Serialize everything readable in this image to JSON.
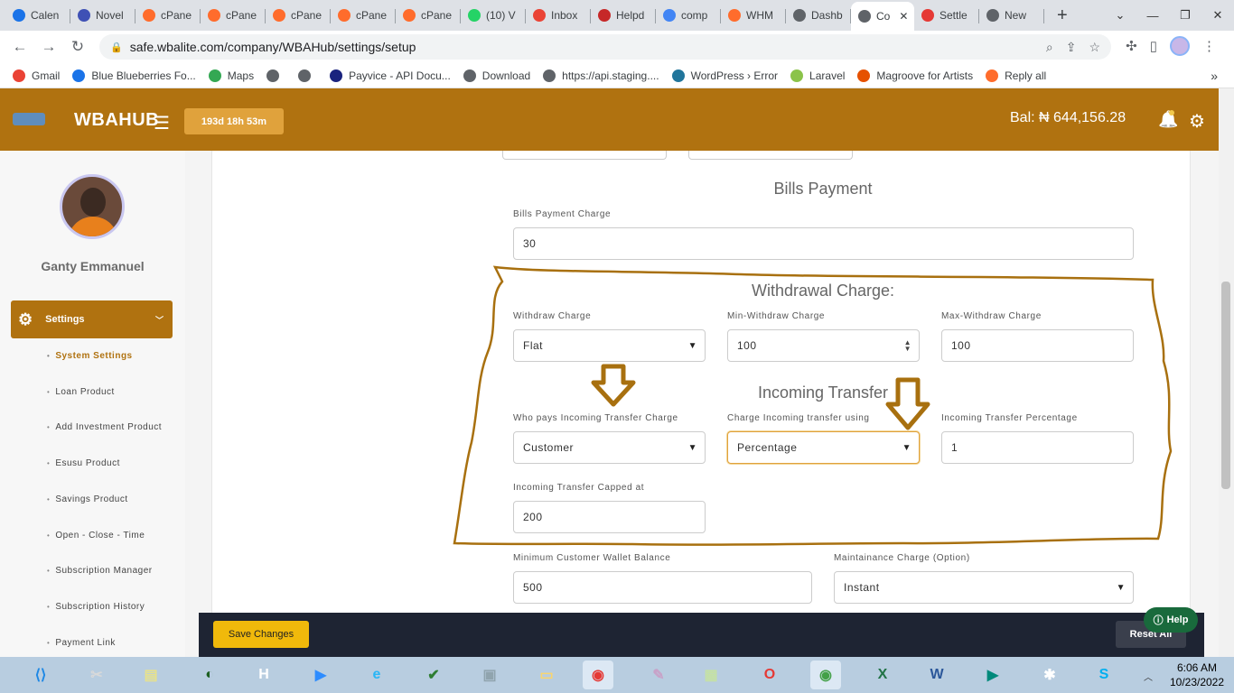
{
  "browser": {
    "tabs": [
      {
        "label": "Calen",
        "color": "#1a73e8"
      },
      {
        "label": "Novel",
        "color": "#3f51b5"
      },
      {
        "label": "cPane",
        "color": "#ff6c2c"
      },
      {
        "label": "cPane",
        "color": "#ff6c2c"
      },
      {
        "label": "cPane",
        "color": "#ff6c2c"
      },
      {
        "label": "cPane",
        "color": "#ff6c2c"
      },
      {
        "label": "cPane",
        "color": "#ff6c2c"
      },
      {
        "label": "(10) V",
        "color": "#25d366"
      },
      {
        "label": "Inbox",
        "color": "#ea4335"
      },
      {
        "label": "Helpd",
        "color": "#c62828"
      },
      {
        "label": "comp",
        "color": "#4285f4"
      },
      {
        "label": "WHM",
        "color": "#ff6c2c"
      },
      {
        "label": "Dashb",
        "color": "#5f6368"
      },
      {
        "label": "Co",
        "color": "#5f6368",
        "active": true
      },
      {
        "label": "Settle",
        "color": "#e53935"
      },
      {
        "label": "New",
        "color": "#5f6368"
      }
    ],
    "new_tab": "+",
    "url": "safe.wbalite.com/company/WBAHub/settings/setup",
    "bookmarks": [
      {
        "label": "Gmail",
        "color": "#ea4335"
      },
      {
        "label": "Blue Blueberries Fo...",
        "color": "#1a73e8"
      },
      {
        "label": "Maps",
        "color": "#34a853"
      },
      {
        "label": "",
        "color": "#5f6368"
      },
      {
        "label": "",
        "color": "#5f6368"
      },
      {
        "label": "Payvice - API Docu...",
        "color": "#1a237e"
      },
      {
        "label": "Download",
        "color": "#5f6368"
      },
      {
        "label": "https://api.staging....",
        "color": "#5f6368"
      },
      {
        "label": "WordPress › Error",
        "color": "#21759b"
      },
      {
        "label": "Laravel",
        "color": "#8bc34a"
      },
      {
        "label": "Magroove for Artists",
        "color": "#e65100"
      },
      {
        "label": "Reply all",
        "color": "#ff6c2c"
      }
    ],
    "bookmarks_more": "»"
  },
  "header": {
    "brand": "WBAHUB",
    "menu_icon": "☰",
    "timer": "193d 18h 53m",
    "balance": "Bal: ₦ 644,156.28",
    "bell_icon": "🔔",
    "gear_icon": "⚙"
  },
  "sidebar": {
    "user_name": "Ganty Emmanuel",
    "settings_label": "Settings",
    "items": [
      {
        "label": "System Settings",
        "active": true
      },
      {
        "label": "Loan Product"
      },
      {
        "label": "Add Investment Product"
      },
      {
        "label": "Esusu Product"
      },
      {
        "label": "Savings Product"
      },
      {
        "label": "Open - Close - Time"
      },
      {
        "label": "Subscription Manager"
      },
      {
        "label": "Subscription History"
      },
      {
        "label": "Payment Link"
      }
    ]
  },
  "bills": {
    "title": "Bills Payment",
    "charge_label": "Bills Payment Charge",
    "charge_value": "30"
  },
  "withdrawal": {
    "title": "Withdrawal Charge:",
    "withdraw_charge_label": "Withdraw Charge",
    "withdraw_charge_value": "Flat",
    "min_label": "Min-Withdraw Charge",
    "min_value": "100",
    "max_label": "Max-Withdraw Charge",
    "max_value": "100"
  },
  "incoming": {
    "title": "Incoming Transfer",
    "who_pays_label": "Who pays Incoming Transfer Charge",
    "who_pays_value": "Customer",
    "charge_using_label": "Charge Incoming transfer using",
    "charge_using_value": "Percentage",
    "percentage_label": "Incoming Transfer Percentage",
    "percentage_value": "1",
    "capped_label": "Incoming Transfer Capped at",
    "capped_value": "200"
  },
  "wallet": {
    "min_balance_label": "Minimum Customer Wallet Balance",
    "min_balance_value": "500",
    "maintenance_label": "Maintainance Charge (Option)",
    "maintenance_value": "Instant"
  },
  "footer": {
    "save_label": "Save Changes",
    "reset_label": "Reset All",
    "help_label": "Help"
  },
  "taskbar": {
    "time": "6:06 AM",
    "date": "10/23/2022"
  },
  "colors": {
    "brand": "#b07210",
    "annotation": "#a8700f",
    "save_button": "#f0b90b",
    "footer_bar": "#1e2433",
    "help_button": "#196a3c"
  }
}
